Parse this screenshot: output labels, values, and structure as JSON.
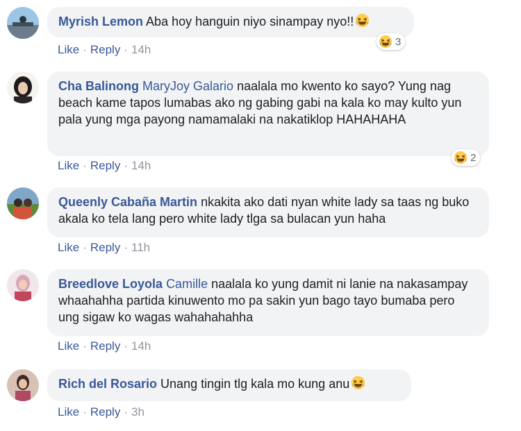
{
  "colors": {
    "author": "#385898",
    "bubble_bg": "#f2f3f5",
    "meta_link": "#385898",
    "meta_text": "#90949c",
    "emoji_face": "#ffcc4d"
  },
  "comments": [
    {
      "author": "Myrish Lemon",
      "mention": "",
      "text": "Aba hoy hanguin niyo sinampay nyo!!",
      "inline_emoji": "laughing-emoji",
      "reaction_icon": "haha-reaction-icon",
      "reaction_count": "3",
      "like": "Like",
      "reply": "Reply",
      "time": "14h"
    },
    {
      "author": "Cha Balinong",
      "mention": "MaryJoy Galario",
      "text": "naalala mo kwento ko sayo? Yung nag beach kame tapos lumabas ako ng gabing gabi na kala ko may kulto yun pala yung mga payong namamalaki na nakatiklop HAHAHAHA",
      "reaction_icon": "haha-reaction-icon",
      "reaction_count": "2",
      "like": "Like",
      "reply": "Reply",
      "time": "14h"
    },
    {
      "author": "Queenly Cabaña Martin",
      "mention": "",
      "text": "nkakita ako dati nyan white lady sa taas ng buko akala ko tela lang pero white lady tlga sa bulacan yun haha",
      "like": "Like",
      "reply": "Reply",
      "time": "11h"
    },
    {
      "author": "Breedlove Loyola",
      "mention": "Camille",
      "text": "naalala ko yung damit ni lanie na nakasampay whaahahha partida kinuwento mo pa sakin yun bago tayo bumaba pero ung sigaw ko wagas wahahahahha",
      "like": "Like",
      "reply": "Reply",
      "time": "14h"
    },
    {
      "author": "Rich del Rosario",
      "mention": "",
      "text": "Unang tingin tlg kala mo kung anu",
      "inline_emoji": "laughing-emoji",
      "like": "Like",
      "reply": "Reply",
      "time": "3h"
    }
  ]
}
